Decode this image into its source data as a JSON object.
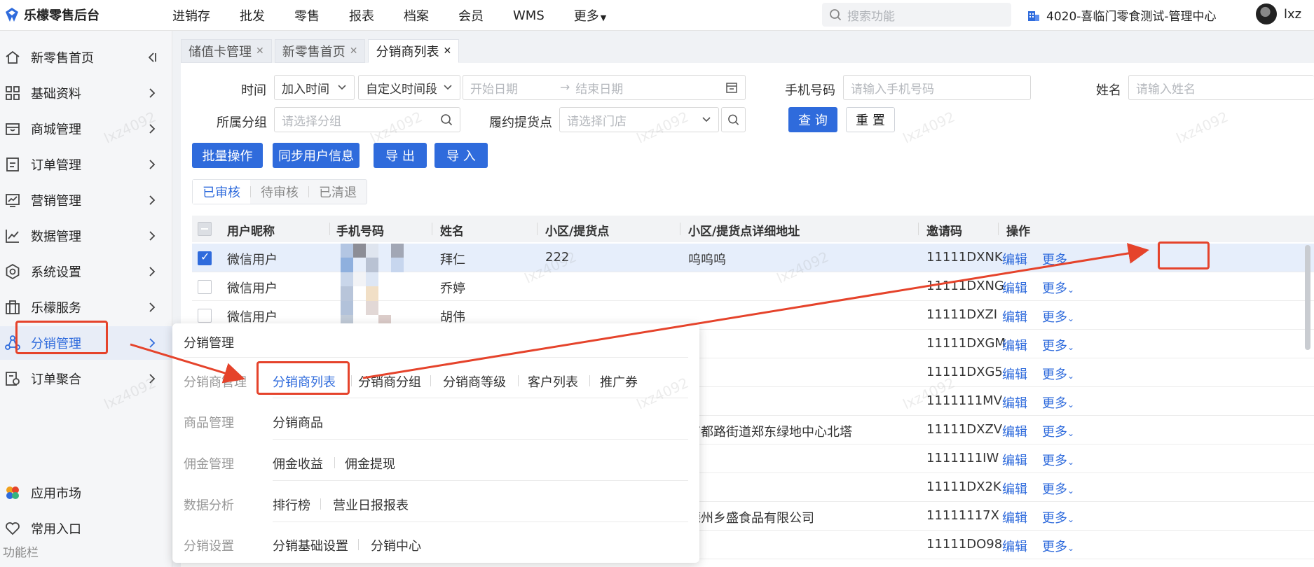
{
  "app": {
    "title": "乐檬零售后台"
  },
  "topnav": [
    "进销存",
    "批发",
    "零售",
    "报表",
    "档案",
    "会员",
    "WMS",
    "更多"
  ],
  "search": {
    "placeholder": "搜索功能"
  },
  "store": {
    "name": "4020-喜临门零食测试-管理中心"
  },
  "user": {
    "name": "lxz"
  },
  "sidebar": {
    "items": [
      {
        "label": "新零售首页",
        "icon": "home-icon"
      },
      {
        "label": "基础资料",
        "icon": "grid-icon"
      },
      {
        "label": "商城管理",
        "icon": "store-icon"
      },
      {
        "label": "订单管理",
        "icon": "order-icon"
      },
      {
        "label": "营销管理",
        "icon": "marketing-icon"
      },
      {
        "label": "数据管理",
        "icon": "chart-icon"
      },
      {
        "label": "系统设置",
        "icon": "settings-icon"
      },
      {
        "label": "乐檬服务",
        "icon": "briefcase-icon"
      },
      {
        "label": "分销管理",
        "icon": "distribution-icon"
      },
      {
        "label": "订单聚合",
        "icon": "aggregate-icon"
      }
    ],
    "bottom": [
      {
        "label": "应用市场",
        "icon": "app-market-icon"
      },
      {
        "label": "常用入口",
        "icon": "heart-icon"
      }
    ],
    "footer": "功能栏"
  },
  "tabs": [
    {
      "label": "储值卡管理"
    },
    {
      "label": "新零售首页"
    },
    {
      "label": "分销商列表"
    }
  ],
  "filters": {
    "time_label": "时间",
    "time_type": "加入时间",
    "time_range": "自定义时间段",
    "start_placeholder": "开始日期",
    "end_placeholder": "结束日期",
    "phone_label": "手机号码",
    "phone_placeholder": "请输入手机号码",
    "name_label": "姓名",
    "name_placeholder": "请输入姓名",
    "group_label": "所属分组",
    "group_placeholder": "请选择分组",
    "pickup_label": "履约提货点",
    "pickup_placeholder": "请选择门店",
    "query": "查 询",
    "reset": "重 置"
  },
  "actions": [
    "批量操作",
    "同步用户信息",
    "导 出",
    "导 入"
  ],
  "status_tabs": [
    "已审核",
    "待审核",
    "已清退"
  ],
  "table": {
    "columns": [
      "用户昵称",
      "手机号码",
      "姓名",
      "小区/提货点",
      "小区/提货点详细地址",
      "邀请码",
      "操作"
    ],
    "rows": [
      {
        "nickname": "微信用户",
        "name": "拜仁",
        "point": "222",
        "address": "呜呜呜",
        "code": "11111DXNK"
      },
      {
        "nickname": "微信用户",
        "name": "乔婷",
        "point": "",
        "address": "",
        "code": "11111DXNG"
      },
      {
        "nickname": "微信用户",
        "name": "胡伟",
        "point": "",
        "address": "",
        "code": "11111DXZI"
      },
      {
        "nickname": "",
        "name": "",
        "point": "",
        "address": "",
        "code": "11111DXGM"
      },
      {
        "nickname": "",
        "name": "",
        "point": "",
        "address": "",
        "code": "11111DXG5"
      },
      {
        "nickname": "",
        "name": "",
        "point": "",
        "address": "",
        "code": "1111111MV"
      },
      {
        "nickname": "",
        "name": "",
        "point": "",
        "address": "商都路街道郑东绿地中心北塔",
        "code": "11111DXZV"
      },
      {
        "nickname": "",
        "name": "",
        "point": "",
        "address": "",
        "code": "1111111IW"
      },
      {
        "nickname": "",
        "name": "",
        "point": "",
        "address": "",
        "code": "11111DX2K"
      },
      {
        "nickname": "",
        "name": "",
        "point": "",
        "address": "德州乡盛食品有限公司",
        "code": "11111117X"
      },
      {
        "nickname": "",
        "name": "",
        "point": "",
        "address": "",
        "code": "11111DO98"
      }
    ],
    "edit_label": "编辑",
    "more_label": "更多"
  },
  "flyout": {
    "title": "分销管理",
    "groups": [
      {
        "label": "分销商管理",
        "links": [
          "分销商列表",
          "分销商分组",
          "分销商等级",
          "客户列表",
          "推广券"
        ]
      },
      {
        "label": "商品管理",
        "links": [
          "分销商品"
        ]
      },
      {
        "label": "佣金管理",
        "links": [
          "佣金收益",
          "佣金提现"
        ]
      },
      {
        "label": "数据分析",
        "links": [
          "排行榜",
          "营业日报报表"
        ]
      },
      {
        "label": "分销设置",
        "links": [
          "分销基础设置",
          "分销中心"
        ]
      }
    ]
  },
  "watermark": "lxz4092",
  "colors": {
    "primary": "#2f6bdc",
    "annotation": "#e5432b"
  }
}
